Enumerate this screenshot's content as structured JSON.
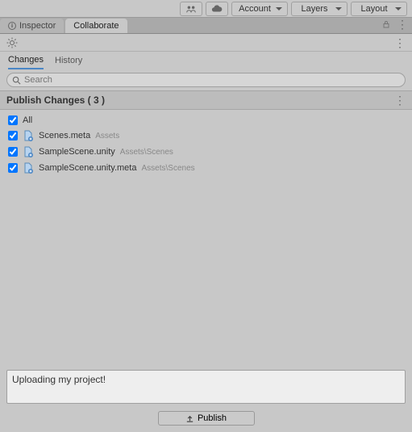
{
  "toolbar": {
    "account_label": "Account",
    "layers_label": "Layers",
    "layout_label": "Layout"
  },
  "tabs": {
    "inspector": "Inspector",
    "collaborate": "Collaborate"
  },
  "subtabs": {
    "changes": "Changes",
    "history": "History"
  },
  "search": {
    "placeholder": "Search"
  },
  "section": {
    "title": "Publish Changes ( 3 )"
  },
  "files": {
    "all_label": "All",
    "items": [
      {
        "name": "Scenes.meta",
        "path": "Assets"
      },
      {
        "name": "SampleScene.unity",
        "path": "Assets\\Scenes"
      },
      {
        "name": "SampleScene.unity.meta",
        "path": "Assets\\Scenes"
      }
    ]
  },
  "commit": {
    "message": "Uploading my project!"
  },
  "publish_btn": "Publish"
}
